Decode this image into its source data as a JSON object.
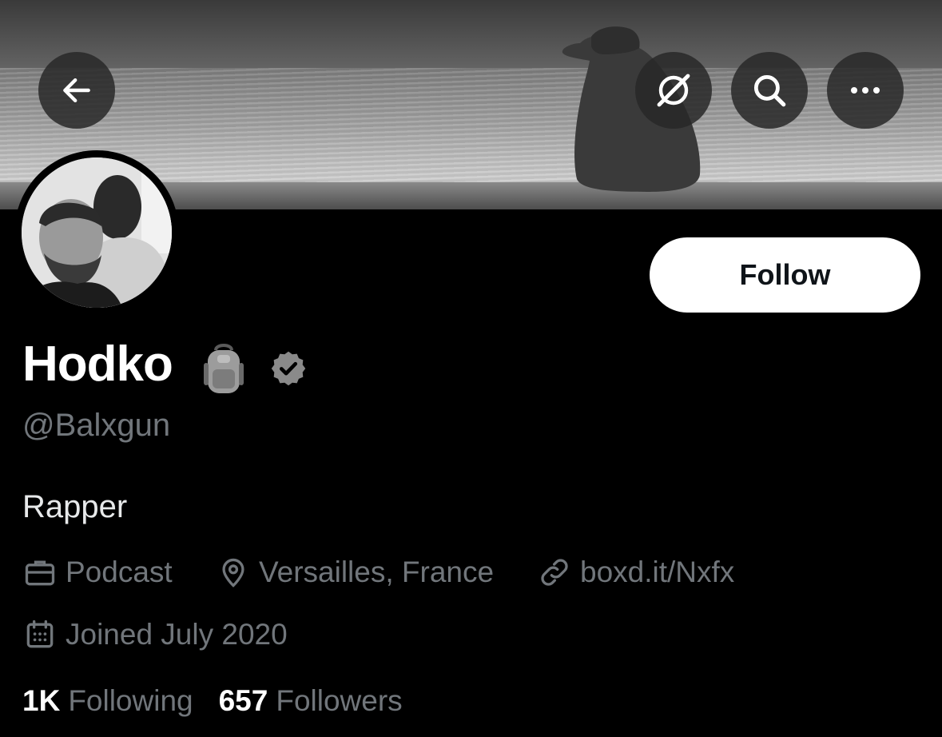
{
  "profile": {
    "display_name": "Hodko",
    "name_emoji_icon": "backpack-icon",
    "verified_icon": "verified-badge-icon",
    "handle": "@Balxgun",
    "bio": "Rapper",
    "category": "Podcast",
    "location": "Versailles, France",
    "website": "boxd.it/Nxfx",
    "joined": "Joined July 2020"
  },
  "actions": {
    "follow_label": "Follow",
    "back_icon": "back-arrow-icon",
    "grok_icon": "grok-icon",
    "search_icon": "search-icon",
    "more_icon": "more-icon"
  },
  "stats": {
    "following_count": "1K",
    "following_label": "Following",
    "followers_count": "657",
    "followers_label": "Followers"
  },
  "colors": {
    "background": "#000000",
    "primary_text": "#ffffff",
    "secondary_text": "#71767b",
    "follow_button_bg": "#ffffff",
    "follow_button_text": "#0f1419"
  }
}
